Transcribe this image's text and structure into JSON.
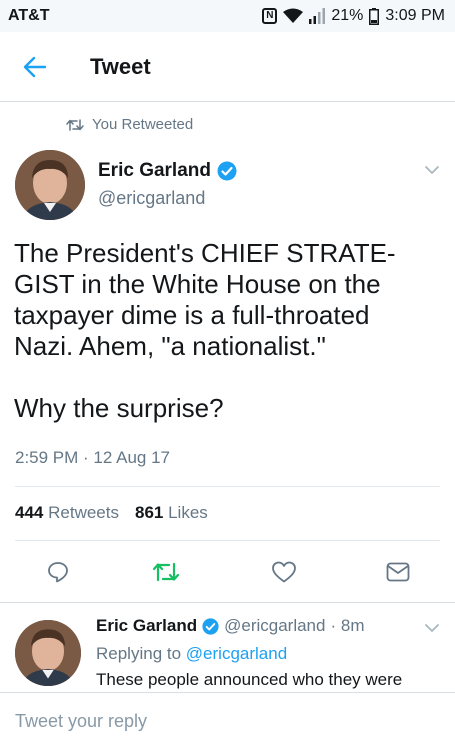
{
  "status_bar": {
    "carrier": "AT&T",
    "nfc": "N",
    "battery": "21%",
    "time": "3:09 PM"
  },
  "header": {
    "title": "Tweet"
  },
  "retweet_context": "You Retweeted",
  "tweet": {
    "author_name": "Eric Garland",
    "author_handle": "@ericgarland",
    "text": "The President's CHIEF STRATE-\nGIST in the White House on the\ntaxpayer dime is a full-throated\nNazi. Ahem, \"a nationalist.\"\n\nWhy the surprise?",
    "timestamp": "2:59 PM · 12 Aug 17",
    "retweets_count": "444",
    "retweets_label": "Retweets",
    "likes_count": "861",
    "likes_label": "Likes"
  },
  "reply": {
    "author_name": "Eric Garland",
    "author_handle": "@ericgarland",
    "age": "· 8m",
    "replying_prefix": "Replying to",
    "replying_handle": "@ericgarland",
    "text": "These people announced who they were"
  },
  "composer": {
    "placeholder": "Tweet your reply"
  },
  "colors": {
    "accent": "#1da1f2",
    "retweet_green": "#17bf63",
    "muted": "#657786"
  },
  "icons": [
    "back-arrow-icon",
    "retweet-icon",
    "verified-icon",
    "chevron-down-icon",
    "reply-icon",
    "like-icon",
    "dm-icon",
    "wifi-icon",
    "signal-icon",
    "battery-icon",
    "nfc-icon"
  ]
}
